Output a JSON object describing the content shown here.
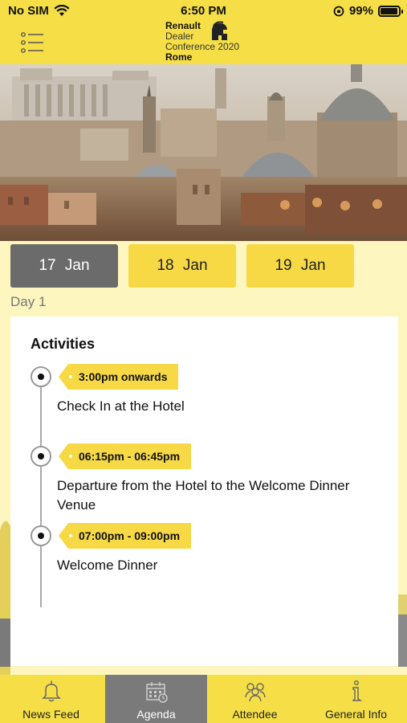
{
  "status_bar": {
    "carrier": "No SIM",
    "time": "6:50 PM",
    "battery": "99%"
  },
  "header": {
    "brand_line1": "Renault",
    "brand_line2": "Dealer",
    "brand_line3": "Conference 2020",
    "brand_line4": "Rome"
  },
  "tabs": [
    {
      "label": "17 Jan",
      "active": true
    },
    {
      "label": "18 Jan",
      "active": false
    },
    {
      "label": "19 Jan",
      "active": false
    }
  ],
  "day_label": "Day 1",
  "activities": {
    "title": "Activities",
    "items": [
      {
        "time": "3:00pm onwards",
        "desc": "Check In at the Hotel"
      },
      {
        "time": "06:15pm - 06:45pm",
        "desc": "Departure from the Hotel to the Welcome Dinner Venue"
      },
      {
        "time": "07:00pm - 09:00pm",
        "desc": "Welcome Dinner"
      }
    ]
  },
  "bottom_nav": [
    {
      "label": "News Feed",
      "icon": "bell-icon"
    },
    {
      "label": "Agenda",
      "icon": "calendar-icon",
      "active": true
    },
    {
      "label": "Attendee",
      "icon": "people-icon"
    },
    {
      "label": "General Info",
      "icon": "info-icon"
    }
  ],
  "colors": {
    "accent": "#f6df46",
    "tab_active": "#6b6b6b",
    "background": "#fdf6bf"
  }
}
